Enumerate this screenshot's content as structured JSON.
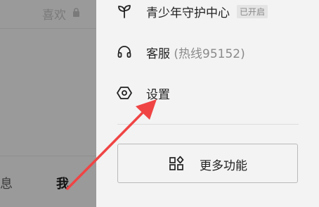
{
  "left_page": {
    "like_label": "喜欢",
    "tab_message": "息",
    "tab_me": "我"
  },
  "drawer": {
    "items": [
      {
        "label": "青少年守护中心",
        "badge": "已开启",
        "icon": "sprout-icon"
      },
      {
        "label": "客服",
        "sub": "(热线95152)",
        "icon": "headset-icon"
      },
      {
        "label": "设置",
        "icon": "hexagon-settings-icon"
      }
    ],
    "more_button": {
      "label": "更多功能",
      "icon": "grid-shapes-icon"
    }
  },
  "colors": {
    "annotation_arrow": "#f04444",
    "overlay": "#9a9a9a"
  }
}
